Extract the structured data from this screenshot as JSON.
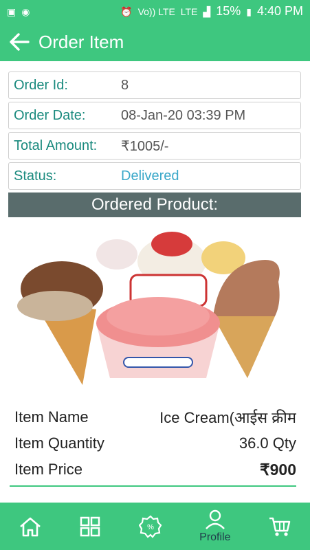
{
  "status_bar": {
    "network_text": "Vo)) LTE",
    "lte2": "LTE",
    "battery": "15%",
    "time": "4:40 PM"
  },
  "appbar": {
    "title": "Order Item"
  },
  "order": {
    "rows": [
      {
        "label": "Order Id:",
        "value": "8"
      },
      {
        "label": "Order Date:",
        "value": "08-Jan-20 03:39 PM"
      },
      {
        "label": "Total Amount:",
        "value": "₹1005/-"
      },
      {
        "label": "Status:",
        "value": "Delivered"
      }
    ]
  },
  "product_section": {
    "heading": "Ordered Product:",
    "image_icon": "ice-cream-image",
    "item_name_label": "Item Name",
    "item_name": "Ice Cream(आईस क्रीम",
    "item_qty_label": "Item Quantity",
    "item_qty": "36.0 Qty",
    "item_price_label": "Item Price",
    "item_price": "₹900"
  },
  "bottom_nav": {
    "profile_label": "Profile",
    "icons": [
      "home-icon",
      "grid-icon",
      "offers-icon",
      "profile-icon",
      "cart-icon"
    ]
  },
  "colors": {
    "primary": "#3ec77f",
    "section_head": "#596c6c",
    "label": "#1a8a7e",
    "delivered": "#3aa8c9"
  }
}
